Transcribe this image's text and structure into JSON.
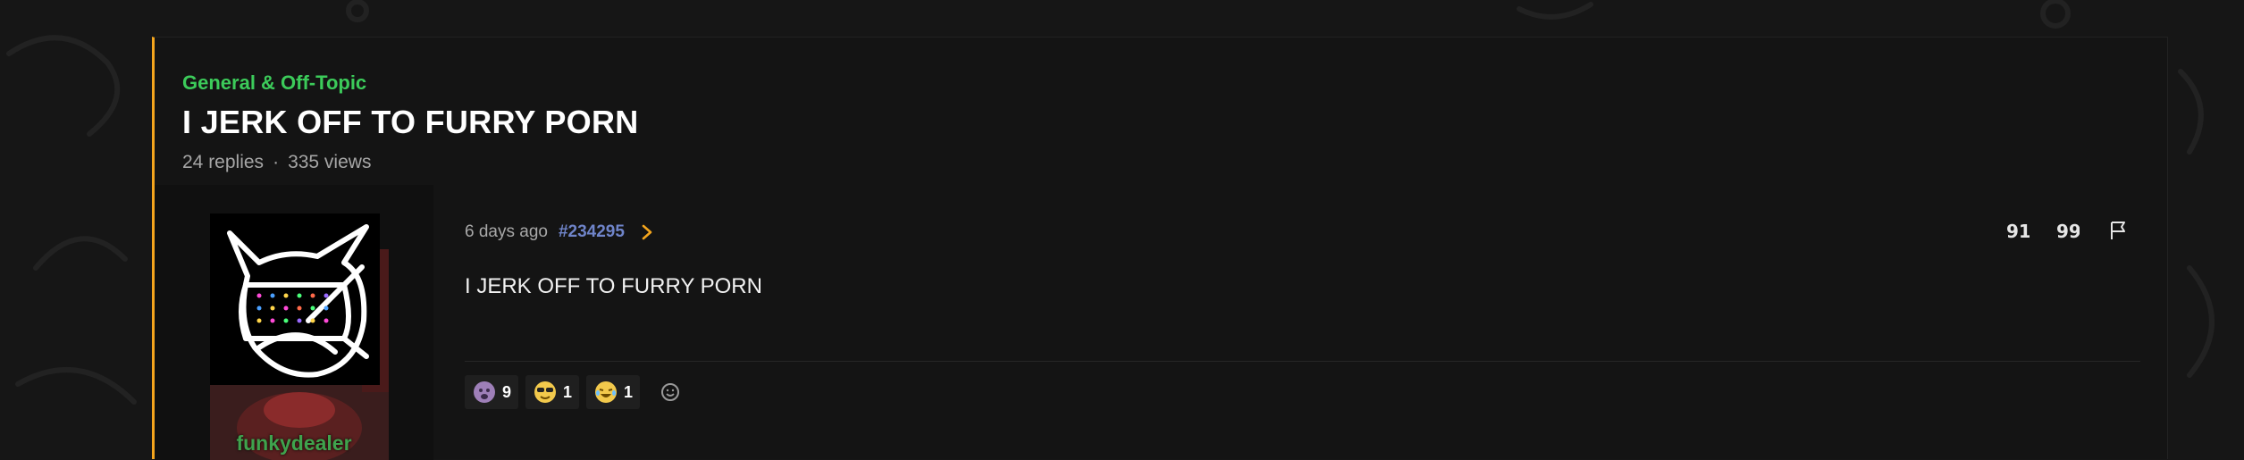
{
  "thread": {
    "category": "General & Off-Topic",
    "title": "I JERK OFF TO FURRY PORN",
    "replies": "24 replies",
    "separator": "·",
    "views": "335 views"
  },
  "post": {
    "author": "funkydealer",
    "time": "6 days ago",
    "id": "#234295",
    "content": "I JERK OFF TO FURRY PORN",
    "reactions": [
      {
        "icon": "purple-face-emoji-icon",
        "count": "9"
      },
      {
        "icon": "sunglasses-emoji-icon",
        "count": "1"
      },
      {
        "icon": "crying-laugh-emoji-icon",
        "count": "1"
      }
    ],
    "actions": [
      "reply-quote-icon",
      "quote-icon",
      "flag-icon"
    ]
  },
  "colors": {
    "accent": "#f4a51d",
    "category": "#3ccb5a",
    "username": "#3fa34d",
    "post_id": "#6f84c9"
  }
}
